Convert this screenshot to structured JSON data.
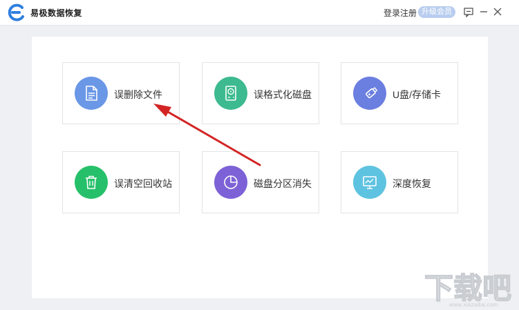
{
  "app": {
    "title": "易极数据恢复"
  },
  "header": {
    "login_label": "登录注册",
    "upgrade_label": "升级会员"
  },
  "colors": {
    "accent": "#2f7fe0",
    "recover_file": "#6a97e6",
    "format_disk": "#3dba8f",
    "usb": "#6b7fe0",
    "recycle": "#27c06a",
    "partition": "#7c62d6",
    "deep": "#5ec3e0",
    "arrow": "#d32424"
  },
  "cards": [
    {
      "label": "误删除文件",
      "icon": "document-icon"
    },
    {
      "label": "误格式化磁盘",
      "icon": "hard-disk-icon"
    },
    {
      "label": "U盘/存储卡",
      "icon": "usb-drive-icon"
    },
    {
      "label": "误清空回收站",
      "icon": "trash-icon"
    },
    {
      "label": "磁盘分区消失",
      "icon": "pie-chart-icon"
    },
    {
      "label": "深度恢复",
      "icon": "monitor-chart-icon"
    }
  ],
  "watermark": {
    "text": "下载吧",
    "url": "www.xiazaiba.com"
  }
}
